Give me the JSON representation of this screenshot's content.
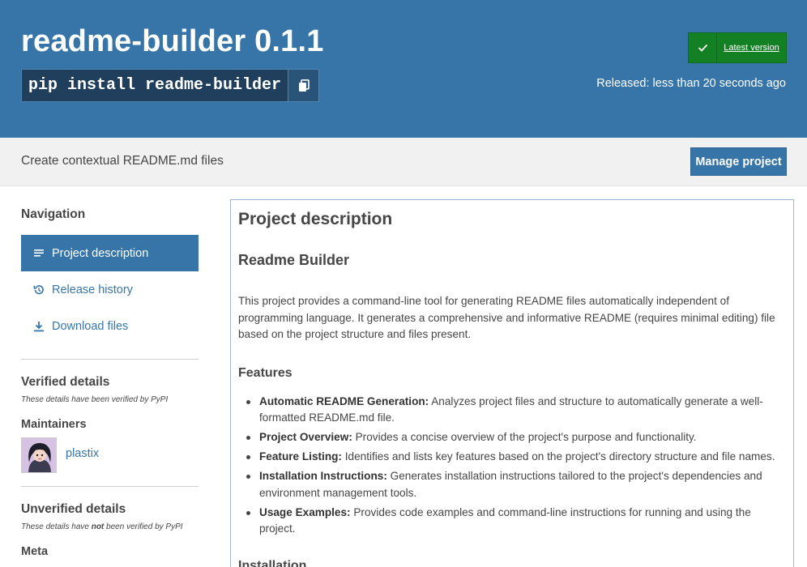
{
  "header": {
    "title": "readme-builder 0.1.1",
    "pip_command": "pip install readme-builder",
    "badge_label": "Latest version",
    "released": "Released: less than 20 seconds ago"
  },
  "summary": {
    "text": "Create contextual README.md files",
    "manage_label": "Manage project"
  },
  "sidebar": {
    "navigation_heading": "Navigation",
    "nav_items": [
      {
        "label": "Project description",
        "icon": "align-left-icon"
      },
      {
        "label": "Release history",
        "icon": "history-icon"
      },
      {
        "label": "Download files",
        "icon": "download-icon"
      }
    ],
    "verified_heading": "Verified details",
    "verified_note": "These details have been verified by PyPI",
    "maintainers_heading": "Maintainers",
    "maintainer": "plastix",
    "unverified_heading": "Unverified details",
    "unverified_note_pre": "These details have ",
    "unverified_note_em": "not",
    "unverified_note_post": " been verified by PyPI",
    "meta_heading": "Meta"
  },
  "content": {
    "title": "Project description",
    "readme_title": "Readme Builder",
    "intro": "This project provides a command-line tool for generating README files automatically independent of programming language. It generates a comprehensive and informative README (requires minimal editing) file based on the project structure and files present.",
    "features_heading": "Features",
    "features": [
      {
        "label": "Automatic README Generation:",
        "text": " Analyzes project files and structure to automatically generate a well-formatted README.md file."
      },
      {
        "label": "Project Overview:",
        "text": " Provides a concise overview of the project's purpose and functionality."
      },
      {
        "label": "Feature Listing:",
        "text": " Identifies and lists key features based on the project's directory structure and file names."
      },
      {
        "label": "Installation Instructions:",
        "text": " Generates installation instructions tailored to the project's dependencies and environment management tools."
      },
      {
        "label": "Usage Examples:",
        "text": " Provides code examples and command-line instructions for running and using the project."
      }
    ],
    "installation_heading": "Installation"
  },
  "colors": {
    "brand_blue": "#3775a9",
    "badge_green": "#148024",
    "text": "#464646"
  }
}
